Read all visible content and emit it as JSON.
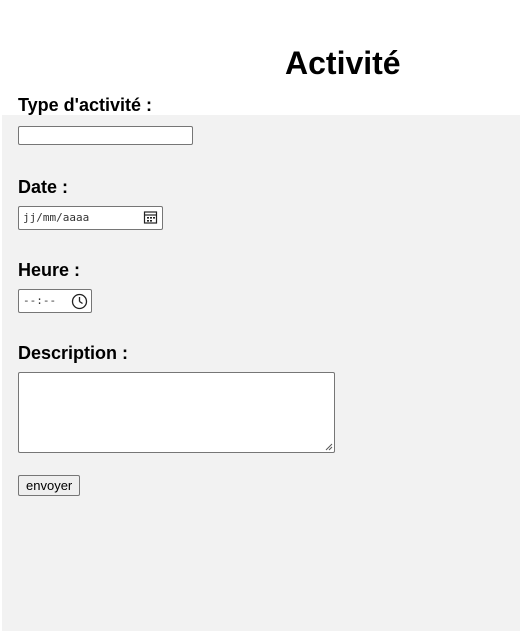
{
  "page": {
    "title": "Activité"
  },
  "form": {
    "type_label": "Type d'activité :",
    "type_value": "",
    "date_label": "Date :",
    "date_placeholder": "jj/mm/aaaa",
    "time_label": "Heure :",
    "time_placeholder": "--:--",
    "description_label": "Description :",
    "description_value": "",
    "submit_label": "envoyer"
  },
  "icons": {
    "date": "calendar-icon",
    "time": "clock-icon"
  },
  "colors": {
    "panel_background": "#f2f2f2",
    "border": "#767676"
  }
}
